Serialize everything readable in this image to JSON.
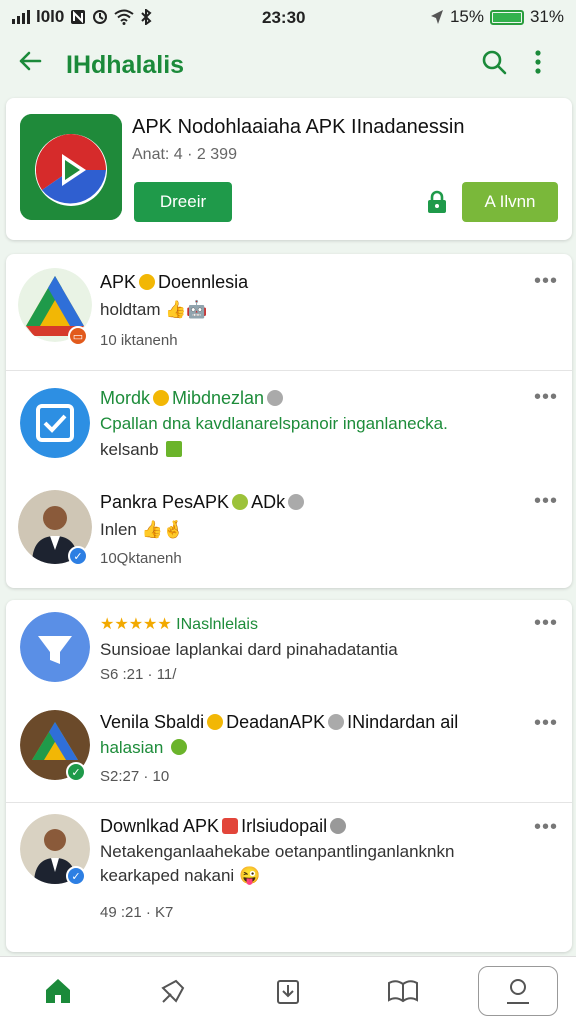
{
  "status_bar": {
    "left_text": "l0l0",
    "time": "23:30",
    "battery_pct": "15%",
    "battery_alt": "31%"
  },
  "app_bar": {
    "title": "IHdhalalis",
    "back_icon": "arrow-left-icon",
    "search_icon": "search-icon",
    "menu_icon": "more-vert-icon"
  },
  "app_card": {
    "title": "APK Nodohlaaiaha APK IInadanessin",
    "subtitle": "Anat: 4 · 2 399",
    "primary_button": "Dreeir",
    "secondary_button": "A Ilvnn"
  },
  "list1": [
    {
      "line1_a": "APK",
      "line1_b": "Doennlesia",
      "line2": "holdtam",
      "line3": "10 iktanenh"
    },
    {
      "line1_a": "Mordk",
      "line1_b": "Mibdnezlan",
      "line2": "Cpallan dna kavdlanarelspanoir inganlanecka.",
      "line3": "kelsanb"
    },
    {
      "line1_a": "Pankra PesAPK",
      "line1_b": "ADk",
      "line2": "Inlen",
      "line3": "10Qktanenh"
    }
  ],
  "list2": [
    {
      "rating": "★★★★★",
      "line1_b": "INaslnlelais",
      "line2": "Sunsioae laplankai dard pinahadatantia",
      "line3": "S6 :21 · 11/"
    },
    {
      "line1_a": "Venila Sbaldi",
      "line1_b": "DeadanAPK",
      "line1_c": "INindardan ail",
      "line2": "halasian",
      "line3": "S2:27 · 10"
    },
    {
      "line1_a": "Downlkad APK",
      "line1_b": "Irlsiudopail",
      "line2": "Netakenganlaahekabe oetanpantlinganlanknkn",
      "line2b": "kearkaped nakani",
      "line3": "49 :21 · K7"
    }
  ],
  "more_label": "•••",
  "bottom_nav": [
    "home-icon",
    "pin-icon",
    "download-icon",
    "book-icon",
    "profile-icon"
  ],
  "colors": {
    "accent": "#1b8a3a",
    "primary_button": "#1f9a4a",
    "secondary_button": "#7ab83a",
    "background": "#eef5ef"
  }
}
